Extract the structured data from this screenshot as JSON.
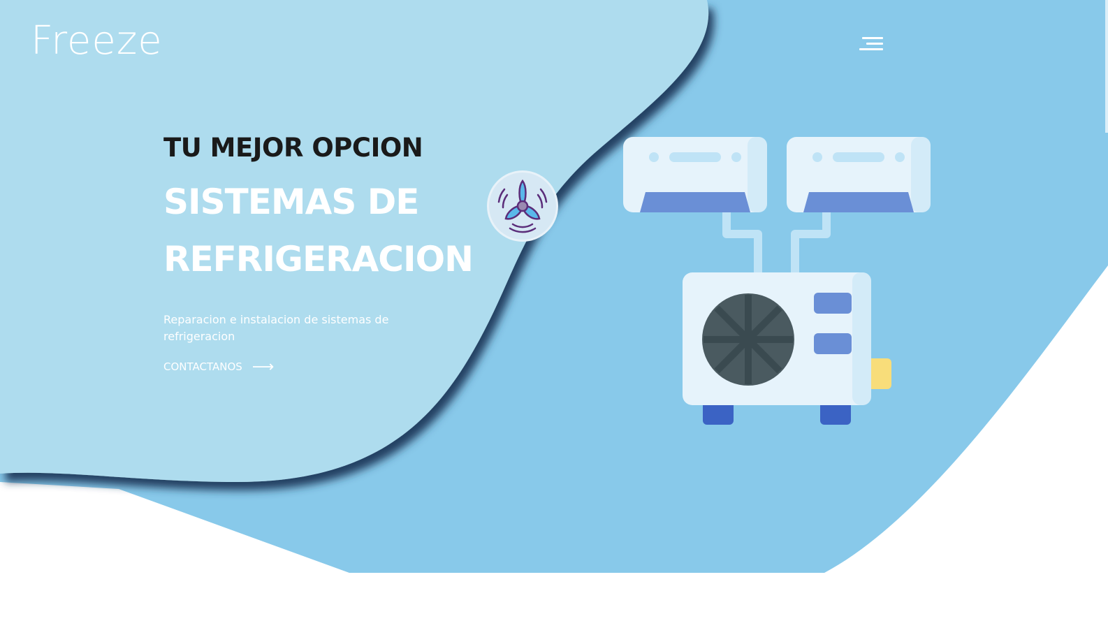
{
  "brand": {
    "logo_text": "Freeze"
  },
  "header": {
    "menu_icon": "hamburger-menu-icon"
  },
  "hero": {
    "kicker": "TU MEJOR OPCION",
    "headline_line1": "SISTEMAS DE",
    "headline_line2": "REFRIGERACION",
    "description": "Reparacion e instalacion de sistemas de refrigeracion",
    "cta_label": "CONTACTANOS",
    "cta_icon": "arrow-right-icon"
  },
  "illustration": {
    "fan_icon": "fan-icon",
    "ac_icon": "air-conditioner-illustration"
  },
  "colors": {
    "light_blue": "#aedcee",
    "mid_blue": "#88c9ea",
    "white": "#ffffff",
    "dark_text": "#1a1a1a",
    "ac_body": "#e6f3fb",
    "ac_vent": "#6a8fd6",
    "ac_fan": "#4a5a60",
    "ac_feet": "#3b63c4",
    "ac_plug": "#f8dd7a"
  }
}
